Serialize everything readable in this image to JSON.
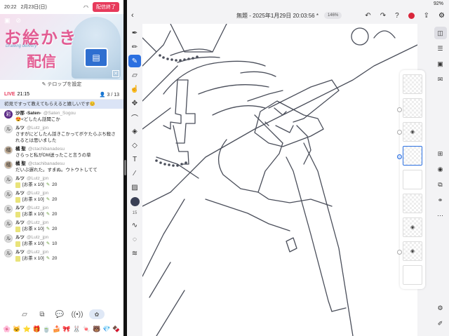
{
  "left_app": {
    "status": {
      "time": "20:22",
      "date": "2月23日(日)",
      "end_button": "配信終了"
    },
    "banner": {
      "title_line1": "お絵かき",
      "subtitle": "Drawing delivery",
      "title_line2": "配信"
    },
    "telop_button": "テロップを設定",
    "live": {
      "label": "LIVE",
      "elapsed": "21:15",
      "viewers": "3 / 13"
    },
    "pinned_comment": "初見ですって教えてもらえると嬉しいです😊",
    "comments": [
      {
        "avatar": "彩",
        "name": "沙那 -Saten-",
        "handle": "@Saten_Sogou",
        "text": "😍<どしたん話聞こか"
      },
      {
        "avatar": "ル",
        "name": "ルツ",
        "handle": "@Lutz_jpn",
        "text": "さすがにどしたん話きこかってボケたらぶち殺されるとは思いました"
      },
      {
        "avatar": "橘",
        "name": "橘 聖",
        "handle": "@ctachibanadesu",
        "text": "さらっと私がDM送ったこと言うの草"
      },
      {
        "avatar": "橘",
        "name": "橘 聖",
        "handle": "@ctachibanadesu",
        "text": "だいぶ遅れた。すまぬ。ウトウトしてて"
      },
      {
        "avatar": "ル",
        "name": "ルツ",
        "handle": "@Lutz_jpn",
        "gift": "[お茶 x 10]",
        "points": "20"
      },
      {
        "avatar": "ル",
        "name": "ルツ",
        "handle": "@Lutz_jpn",
        "gift": "[お茶 x 10]",
        "points": "20"
      },
      {
        "avatar": "ル",
        "name": "ルツ",
        "handle": "@Lutz_jpn",
        "gift": "[お茶 x 10]",
        "points": "20"
      },
      {
        "avatar": "ル",
        "name": "ルツ",
        "handle": "@Lutz_jpn",
        "gift": "[お茶 x 10]",
        "points": "20"
      },
      {
        "avatar": "ル",
        "name": "ルツ",
        "handle": "@Lutz_jpn",
        "gift": "[お茶 x 10]",
        "points": "10"
      },
      {
        "avatar": "ル",
        "name": "ルツ",
        "handle": "@Lutz_jpn",
        "gift": "[お茶 x 10]",
        "points": "20"
      }
    ],
    "gift_icons": [
      "🌸",
      "🐱",
      "⭐",
      "🎁",
      "🍵",
      "🍰",
      "🎀",
      "🐰",
      "🍬",
      "🐻",
      "💎",
      "🍫"
    ]
  },
  "right_app": {
    "status": {
      "battery": "92%"
    },
    "title": "無題 - 2025年1月29日 20:03:56 *",
    "zoom": "146%",
    "brush_size": "15",
    "colors": {
      "accent": "#2b6fe0",
      "current_color": "#3a4055"
    }
  }
}
